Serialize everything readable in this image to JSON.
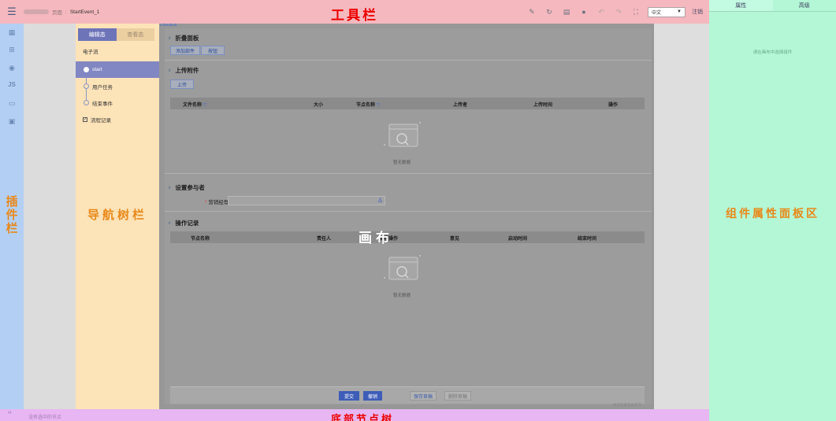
{
  "toolbar": {
    "breadcrumb_page": "页面",
    "breadcrumb_sep": ":",
    "breadcrumb_current": "StartEvent_1",
    "title": "工具栏",
    "language": "中文",
    "logout": "注销",
    "icons": [
      "brush-icon",
      "refresh-icon",
      "save-icon",
      "settings-icon",
      "undo-icon",
      "redo-icon",
      "fullscreen-icon"
    ]
  },
  "plugin_bar": {
    "title_chars": [
      "插",
      "件",
      "栏"
    ],
    "items": [
      "component-icon",
      "tree-icon",
      "data-source-icon",
      "JS",
      "variable-icon",
      "template-icon"
    ]
  },
  "nav_tree": {
    "tabs": [
      {
        "label": "编辑态",
        "active": true
      },
      {
        "label": "查看态",
        "active": false
      }
    ],
    "flow_name": "电子流",
    "nodes": [
      {
        "label": "start",
        "selected": true
      },
      {
        "label": "用户任务",
        "selected": false
      },
      {
        "label": "结束事件",
        "selected": false
      }
    ],
    "record_label": "流程记录",
    "title": "导航树栏"
  },
  "canvas": {
    "tag": "LcbSubmit",
    "center_label": "画布",
    "sections": {
      "fold_panel": {
        "title": "折叠面板",
        "buttons": [
          "添加部件",
          "按钮"
        ]
      },
      "upload": {
        "title": "上传附件",
        "button": "上传",
        "columns": [
          "文件名称",
          "大小",
          "节点名称",
          "上传者",
          "上传时间",
          "操作"
        ],
        "empty_text": "暂无数据"
      },
      "participants": {
        "title": "设置参与者",
        "field_label": "营销经理",
        "required_mark": "*"
      },
      "records": {
        "title": "操作记录",
        "columns": [
          "节点名称",
          "责任人",
          "流程操作",
          "意见",
          "启动时间",
          "结束时间"
        ],
        "empty_text": "暂无数据"
      }
    },
    "footer_buttons": [
      "提交",
      "撤销",
      "保存草稿",
      "删除草稿"
    ],
    "drag_hint": "拖放元素至画布内"
  },
  "properties": {
    "tabs": [
      {
        "label": "属性",
        "active": true
      },
      {
        "label": "高级",
        "active": false
      }
    ],
    "hint": "请在画布中选择组件",
    "title": "组件属性面板区"
  },
  "bottom_tree": {
    "status": "没有选中的节点",
    "title": "底部节点树"
  }
}
